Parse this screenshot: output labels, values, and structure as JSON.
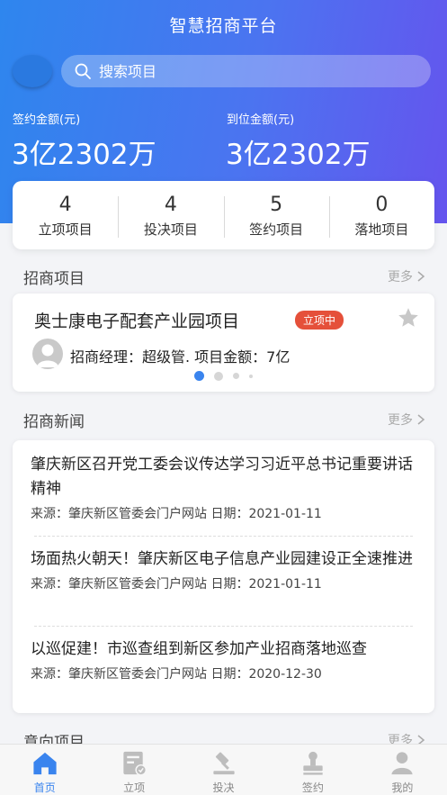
{
  "app": {
    "title": "智慧招商平台"
  },
  "search": {
    "placeholder": "搜索项目"
  },
  "amounts": [
    {
      "label": "签约金额(元)",
      "value": "3亿2302万"
    },
    {
      "label": "到位金额(元)",
      "value": "3亿2302万"
    }
  ],
  "stats": [
    {
      "num": "4",
      "label": "立项项目"
    },
    {
      "num": "4",
      "label": "投决项目"
    },
    {
      "num": "5",
      "label": "签约项目"
    },
    {
      "num": "0",
      "label": "落地项目"
    }
  ],
  "sections": {
    "projects": {
      "title": "招商项目",
      "more": "更多"
    },
    "news": {
      "title": "招商新闻",
      "more": "更多"
    },
    "intent": {
      "title": "意向项目",
      "more": "更多"
    }
  },
  "project_card": {
    "name": "奥士康电子配套产业园项目",
    "status": "立项中",
    "info": "招商经理：超级管.  项目金额：7亿",
    "carousel_active_index": 0,
    "carousel_count": 4
  },
  "news": [
    {
      "title": "肇庆新区召开党工委会议传达学习习近平总书记重要讲话精神",
      "meta": "来源：肇庆新区管委会门户网站 日期：2021-01-11"
    },
    {
      "title": "场面热火朝天！肇庆新区电子信息产业园建设正全速推进",
      "meta": "来源：肇庆新区管委会门户网站 日期：2021-01-11"
    },
    {
      "title": "以巡促建！市巡查组到新区参加产业招商落地巡查",
      "meta": "来源：肇庆新区管委会门户网站 日期：2020-12-30"
    }
  ],
  "tabbar": [
    {
      "label": "首页",
      "icon": "home-icon",
      "active": true
    },
    {
      "label": "立项",
      "icon": "checklist-icon",
      "active": false
    },
    {
      "label": "投决",
      "icon": "gavel-icon",
      "active": false
    },
    {
      "label": "签约",
      "icon": "stamp-icon",
      "active": false
    },
    {
      "label": "我的",
      "icon": "user-icon",
      "active": false
    }
  ],
  "colors": {
    "accent": "#3a84ee",
    "badge": "#e5503a",
    "hero_start": "#2e86ee",
    "hero_end": "#6554ee"
  }
}
